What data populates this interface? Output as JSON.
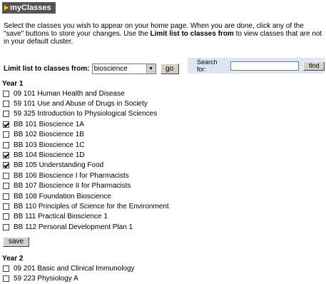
{
  "header": {
    "title": "myClasses"
  },
  "intro": {
    "text1": "Select the classes you wish to appear on your home page. When you are done, click any of the \"save\" buttons to store your changes. Use the ",
    "bold": "Limit list to classes from",
    "text2": " to view classes that are not in your default cluster."
  },
  "filter": {
    "label": "Limit list to classes from:",
    "selected": "bioscience",
    "go_label": "go"
  },
  "search": {
    "label": "Search for:",
    "value": "",
    "placeholder": "",
    "find_label": "find"
  },
  "years": [
    {
      "heading": "Year 1",
      "classes": [
        {
          "label": "09 101 Human Health and Disease",
          "checked": false
        },
        {
          "label": "59 101 Use and Abuse of Drugs in Society",
          "checked": false
        },
        {
          "label": "59 325 Introduction to Physiological Sciences",
          "checked": false
        },
        {
          "label": "BB 101 Bioscience 1A",
          "checked": true
        },
        {
          "label": "BB 102 Bioscience 1B",
          "checked": false
        },
        {
          "label": "BB 103 Bioscience 1C",
          "checked": false
        },
        {
          "label": "BB 104 Bioscience 1D",
          "checked": true
        },
        {
          "label": "BB 105 Understanding Food",
          "checked": true
        },
        {
          "label": "BB 106 Bioscience I for Pharmacists",
          "checked": false
        },
        {
          "label": "BB 107 Bioscience II for Pharmacists",
          "checked": false
        },
        {
          "label": "BB 108 Foundation Bioscience",
          "checked": false
        },
        {
          "label": "BB 110 Principles of Science for the Environment",
          "checked": false
        },
        {
          "label": "BB 111 Practical Bioscience 1",
          "checked": false
        },
        {
          "label": "BB 112 Personal Development Plan 1",
          "checked": false
        }
      ],
      "save_label": "save"
    },
    {
      "heading": "Year 2",
      "classes": [
        {
          "label": "09 201 Basic and Clinical Immunology",
          "checked": false
        },
        {
          "label": "59 223 Physiology A",
          "checked": false
        }
      ]
    }
  ]
}
